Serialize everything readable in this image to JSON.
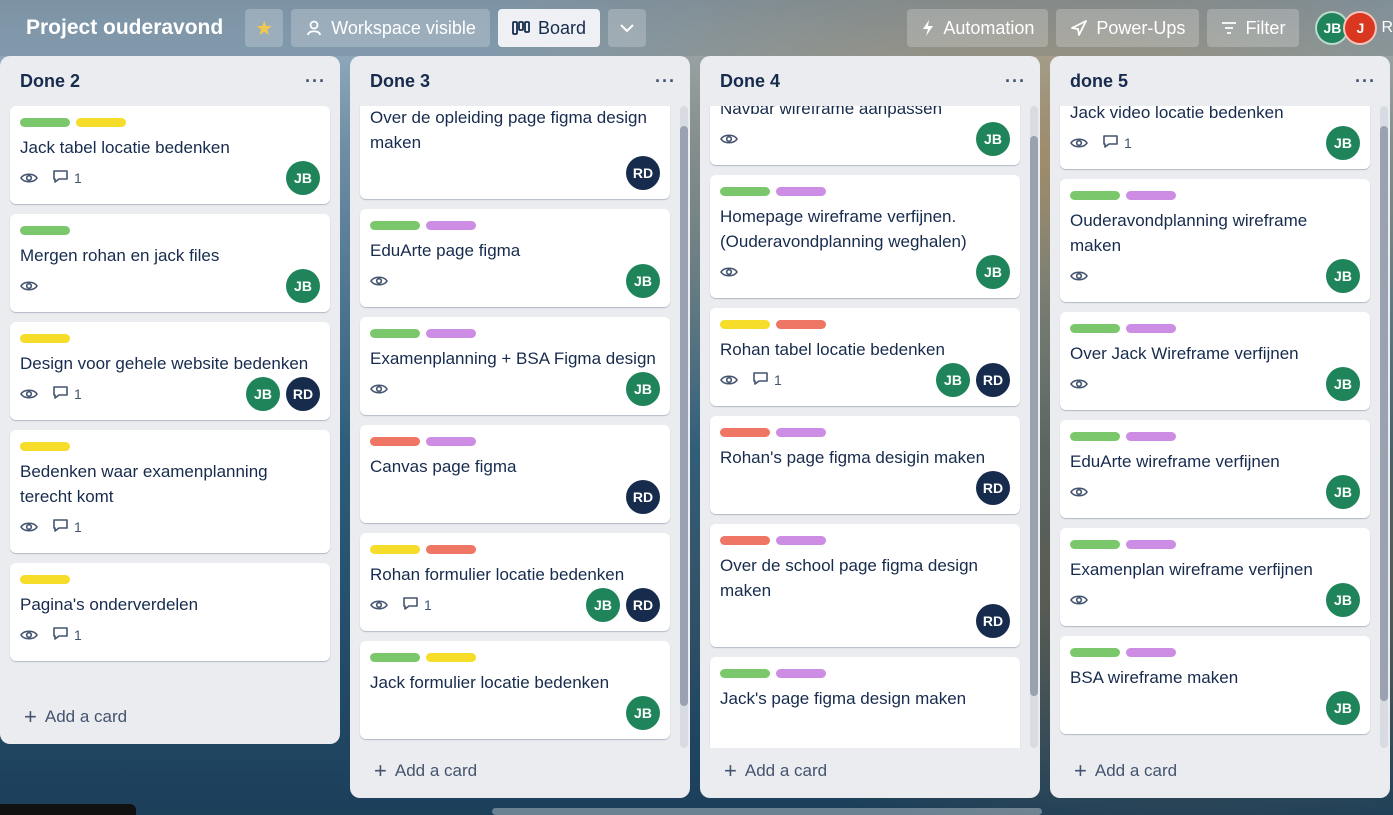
{
  "header": {
    "board_title": "Project ouderavond",
    "visibility_label": "Workspace visible",
    "view_label": "Board",
    "automation_label": "Automation",
    "powerups_label": "Power-Ups",
    "filter_label": "Filter",
    "members": [
      "JB",
      "J"
    ],
    "trailing_text": "R"
  },
  "label_colors": {
    "green": "#7bc86c",
    "yellow": "#f5dd29",
    "red": "#ef7564",
    "purple": "#cd8de5"
  },
  "avatar_colors": {
    "JB": "#1f845a",
    "RD": "#172b4d"
  },
  "add_card_label": "Add a card",
  "lists": [
    {
      "title": "Done 2",
      "cards": [
        {
          "labels": [
            "green",
            "yellow"
          ],
          "title": "Jack tabel locatie bedenken",
          "watch": true,
          "comments": "1",
          "members": [
            "JB"
          ]
        },
        {
          "labels": [
            "green"
          ],
          "title": "Mergen rohan en jack files",
          "watch": true,
          "comments": "",
          "members": [
            "JB"
          ]
        },
        {
          "labels": [
            "yellow"
          ],
          "title": "Design voor gehele website bedenken",
          "watch": true,
          "comments": "1",
          "members": [
            "JB",
            "RD"
          ]
        },
        {
          "labels": [
            "yellow"
          ],
          "title": "Bedenken waar examenplanning terecht komt",
          "watch": true,
          "comments": "1",
          "members": []
        },
        {
          "labels": [
            "yellow"
          ],
          "title": "Pagina's onderverdelen",
          "watch": true,
          "comments": "1",
          "members": []
        }
      ]
    },
    {
      "title": "Done 3",
      "cards": [
        {
          "labels": [
            "red",
            "purple"
          ],
          "title": "Over de opleiding page figma design maken",
          "watch": false,
          "comments": "",
          "members": [
            "RD"
          ]
        },
        {
          "labels": [
            "green",
            "purple"
          ],
          "title": "EduArte page figma",
          "watch": true,
          "comments": "",
          "members": [
            "JB"
          ]
        },
        {
          "labels": [
            "green",
            "purple"
          ],
          "title": "Examenplanning + BSA Figma design",
          "watch": true,
          "comments": "",
          "members": [
            "JB"
          ]
        },
        {
          "labels": [
            "red",
            "purple"
          ],
          "title": "Canvas page figma",
          "watch": false,
          "comments": "",
          "members": [
            "RD"
          ]
        },
        {
          "labels": [
            "yellow",
            "red"
          ],
          "title": "Rohan formulier locatie bedenken",
          "watch": true,
          "comments": "1",
          "members": [
            "JB",
            "RD"
          ]
        },
        {
          "labels": [
            "green",
            "yellow"
          ],
          "title": "Jack formulier locatie bedenken",
          "watch": false,
          "comments": "",
          "members": [
            "JB"
          ]
        }
      ]
    },
    {
      "title": "Done 4",
      "cards": [
        {
          "labels": [],
          "title": "Navbar wireframe aanpassen",
          "watch": true,
          "comments": "",
          "members": [
            "JB"
          ]
        },
        {
          "labels": [
            "green",
            "purple"
          ],
          "title": "Homepage wireframe verfijnen. (Ouderavondplanning weghalen)",
          "watch": true,
          "comments": "",
          "members": [
            "JB"
          ]
        },
        {
          "labels": [
            "yellow",
            "red"
          ],
          "title": "Rohan tabel locatie bedenken",
          "watch": true,
          "comments": "1",
          "members": [
            "JB",
            "RD"
          ]
        },
        {
          "labels": [
            "red",
            "purple"
          ],
          "title": "Rohan's page figma desigin maken",
          "watch": false,
          "comments": "",
          "members": [
            "RD"
          ]
        },
        {
          "labels": [
            "red",
            "purple"
          ],
          "title": "Over de school page figma design maken",
          "watch": false,
          "comments": "",
          "members": [
            "RD"
          ]
        },
        {
          "labels": [
            "green",
            "purple"
          ],
          "title": "Jack's page figma design maken",
          "watch": false,
          "comments": "",
          "members": []
        }
      ]
    },
    {
      "title": "done 5",
      "cards": [
        {
          "labels": [
            "green",
            "yellow"
          ],
          "title": "Jack video locatie bedenken",
          "watch": true,
          "comments": "1",
          "members": [
            "JB"
          ]
        },
        {
          "labels": [
            "green",
            "purple"
          ],
          "title": "Ouderavondplanning wireframe maken",
          "watch": true,
          "comments": "",
          "members": [
            "JB"
          ]
        },
        {
          "labels": [
            "green",
            "purple"
          ],
          "title": "Over Jack Wireframe verfijnen",
          "watch": true,
          "comments": "",
          "members": [
            "JB"
          ]
        },
        {
          "labels": [
            "green",
            "purple"
          ],
          "title": "EduArte wireframe verfijnen",
          "watch": true,
          "comments": "",
          "members": [
            "JB"
          ]
        },
        {
          "labels": [
            "green",
            "purple"
          ],
          "title": "Examenplan wireframe verfijnen",
          "watch": true,
          "comments": "",
          "members": [
            "JB"
          ]
        },
        {
          "labels": [
            "green",
            "purple"
          ],
          "title": "BSA wireframe maken",
          "watch": false,
          "comments": "",
          "members": [
            "JB"
          ]
        }
      ]
    }
  ]
}
